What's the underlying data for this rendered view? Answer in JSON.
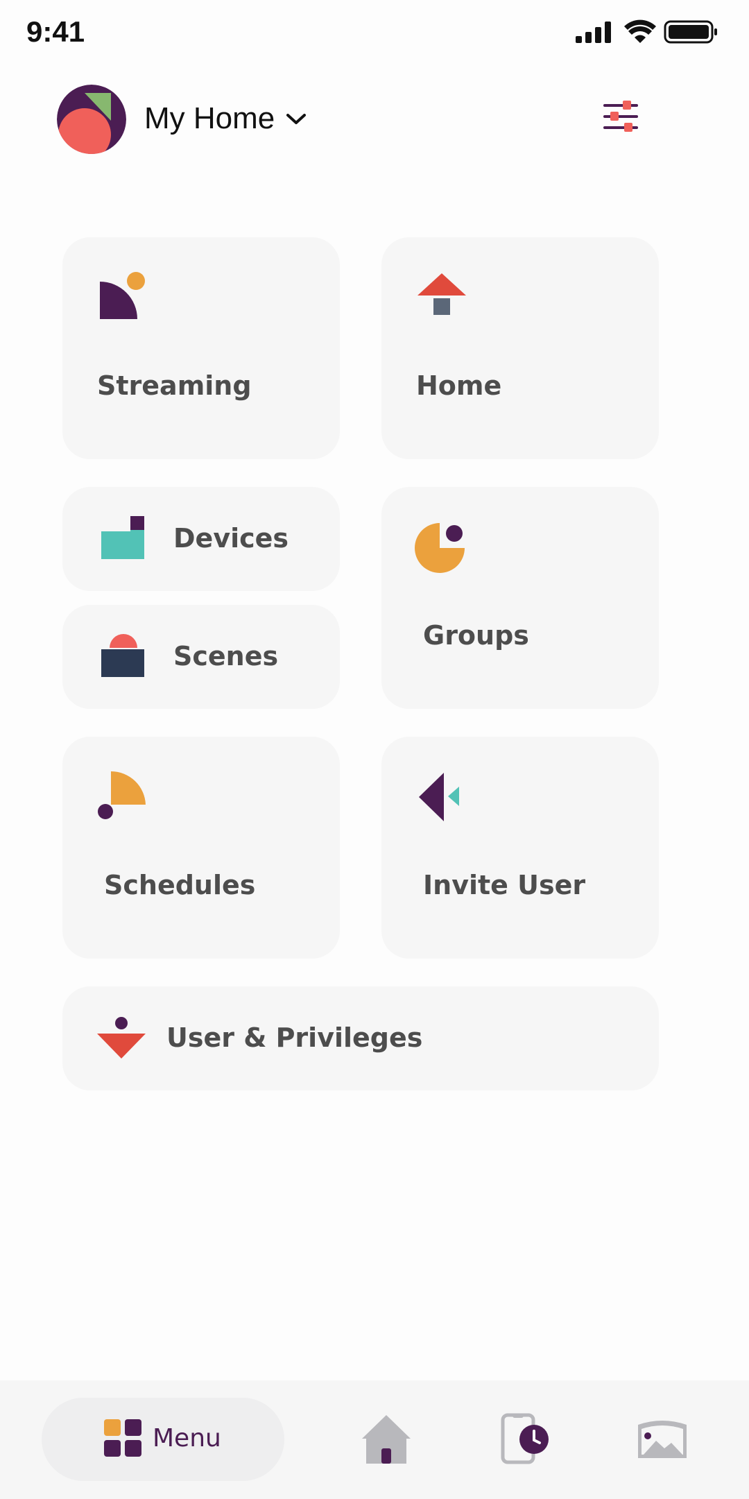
{
  "status_bar": {
    "time": "9:41"
  },
  "header": {
    "home_name": "My Home"
  },
  "tiles": {
    "streaming": "Streaming",
    "home": "Home",
    "devices": "Devices",
    "scenes": "Scenes",
    "groups": "Groups",
    "schedules": "Schedules",
    "invite_user": "Invite User",
    "user_privileges": "User & Privileges"
  },
  "bottom_nav": {
    "menu_label": "Menu"
  },
  "colors": {
    "purple": "#4b1d53",
    "coral": "#f0605a",
    "red": "#e04a3c",
    "orange": "#eba13d",
    "teal": "#52c2b6",
    "navy": "#2c3a53",
    "green": "#87b86f",
    "gray_icon": "#b8b8bc"
  }
}
